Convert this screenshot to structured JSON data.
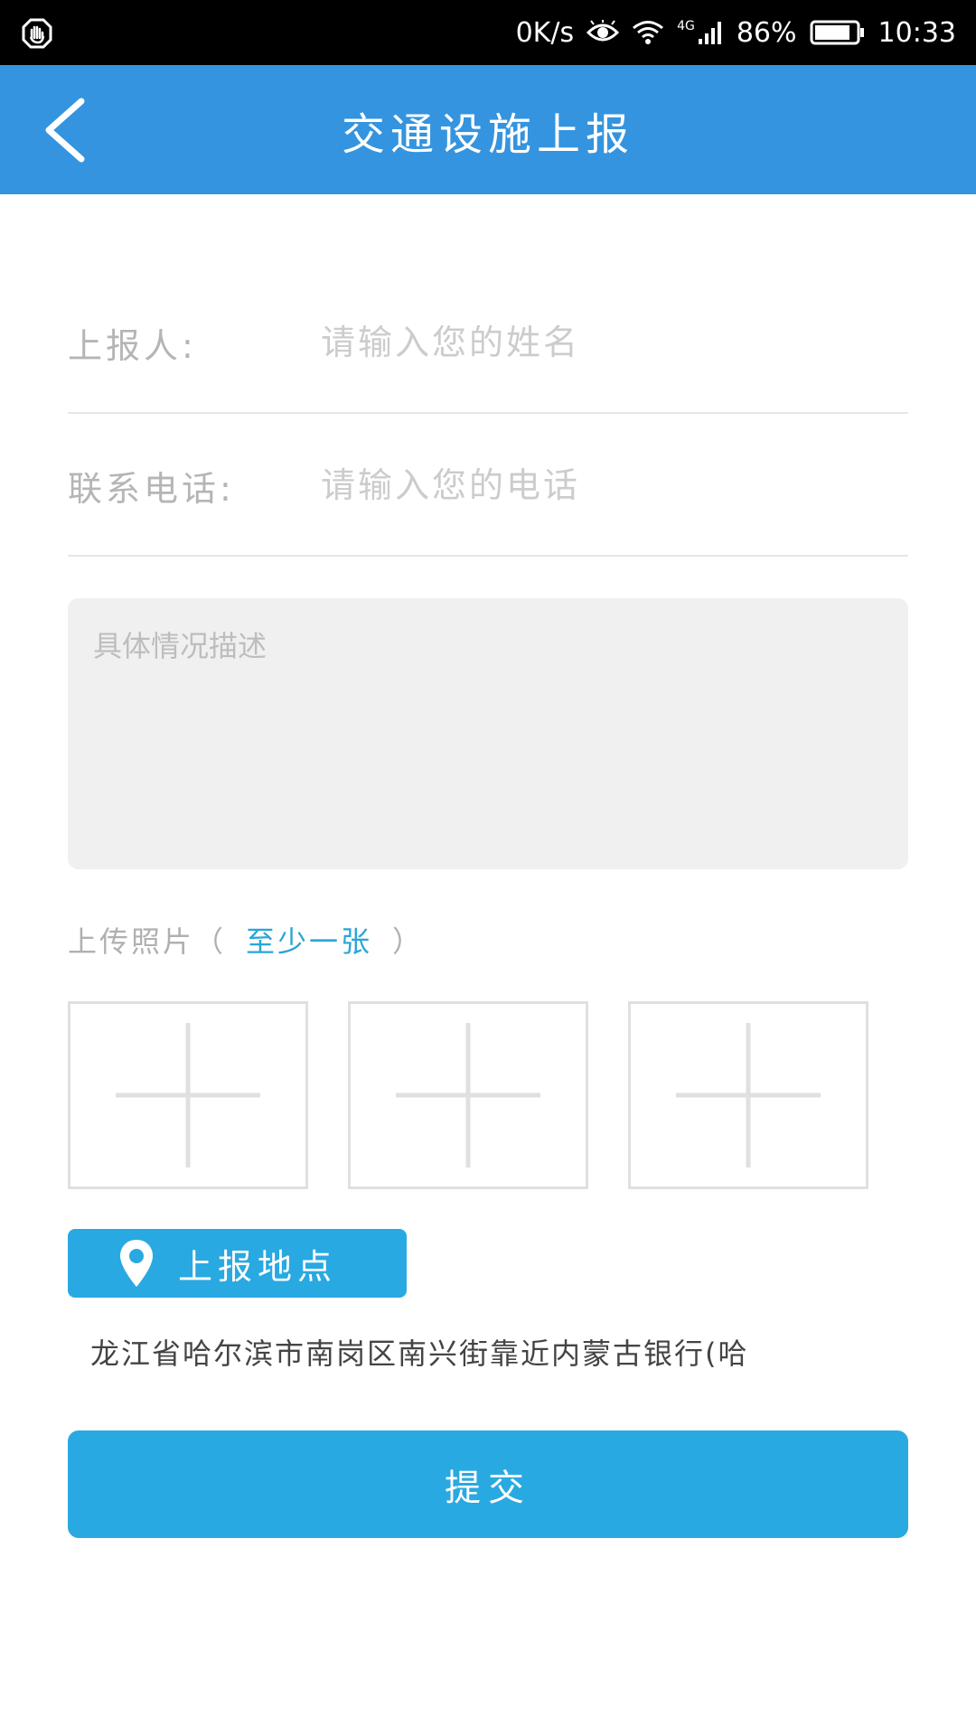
{
  "status_bar": {
    "speed": "0K/s",
    "network": "4G",
    "battery_percent": "86%",
    "battery_level": 0.86,
    "time": "10:33",
    "icons": [
      "hand-icon",
      "eye-icon",
      "wifi-icon",
      "signal-icon",
      "battery-icon"
    ]
  },
  "header": {
    "title": "交通设施上报",
    "back_icon": "back-arrow-icon",
    "background": "#3494df"
  },
  "form": {
    "name_label": "上报人:",
    "name_placeholder": "请输入您的姓名",
    "phone_label": "联系电话:",
    "phone_placeholder": "请输入您的电话",
    "description_placeholder": "具体情况描述"
  },
  "upload": {
    "label_prefix": "上传照片（",
    "label_hint": "至少一张",
    "label_suffix": "）",
    "slot_icon": "add-plus-icon",
    "slots": 3
  },
  "location": {
    "button_label": "上报地点",
    "icon": "location-pin-icon",
    "address": "龙江省哈尔滨市南岗区南兴街靠近内蒙古银行(哈"
  },
  "submit": {
    "label": "提交"
  },
  "colors": {
    "accent": "#29a9e1",
    "header": "#3494df",
    "hint": "#2aa5d8"
  }
}
